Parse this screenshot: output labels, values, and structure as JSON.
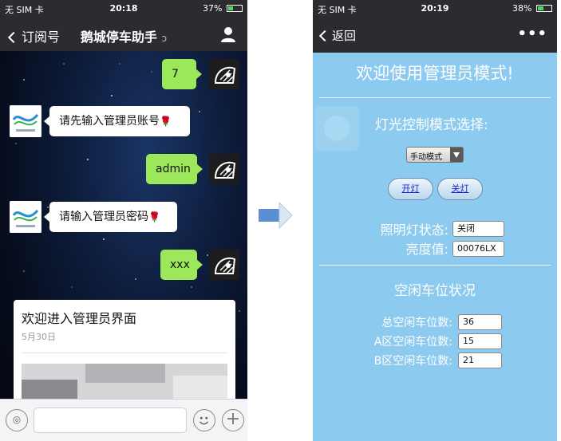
{
  "left_phone": {
    "status": {
      "carrier": "无 SIM 卡",
      "time": "20:18",
      "battery": "37%"
    },
    "nav": {
      "back_label": "订阅号",
      "title": "鹅城停车助手"
    },
    "messages": [
      {
        "side": "right",
        "text": "7"
      },
      {
        "side": "left",
        "text": "请先输入管理员账号"
      },
      {
        "side": "right",
        "text": "admin"
      },
      {
        "side": "left",
        "text": "请输入管理员密码"
      },
      {
        "side": "right",
        "text": "xxx"
      }
    ],
    "rose": "🌹",
    "card": {
      "title": "欢迎进入管理员界面",
      "date": "5月30日"
    }
  },
  "right_phone": {
    "status": {
      "carrier": "无 SIM 卡",
      "time": "20:19",
      "battery": "38%"
    },
    "nav": {
      "back_label": "返回",
      "more_icon": "•••"
    },
    "title": "欢迎使用管理员模式!",
    "light_control_label": "灯光控制模式选择:",
    "mode_select_value": "手动模式",
    "on_button": "开灯",
    "off_button": "关灯",
    "light_status_label": "照明灯状态:",
    "light_status_value": "关闭",
    "brightness_label": "亮度值:",
    "brightness_value": "00076LX",
    "parking_title": "空闲车位状况",
    "total_label": "总空闲车位数:",
    "total_value": "36",
    "a_label": "A区空闲车位数:",
    "a_value": "15",
    "b_label": "B区空闲车位数:",
    "b_value": "21"
  },
  "colors": {
    "chat_green": "#9de75a",
    "admin_bg": "#8ccbef",
    "navbar": "#2c2c30",
    "arrow": "#5b8fd2"
  }
}
